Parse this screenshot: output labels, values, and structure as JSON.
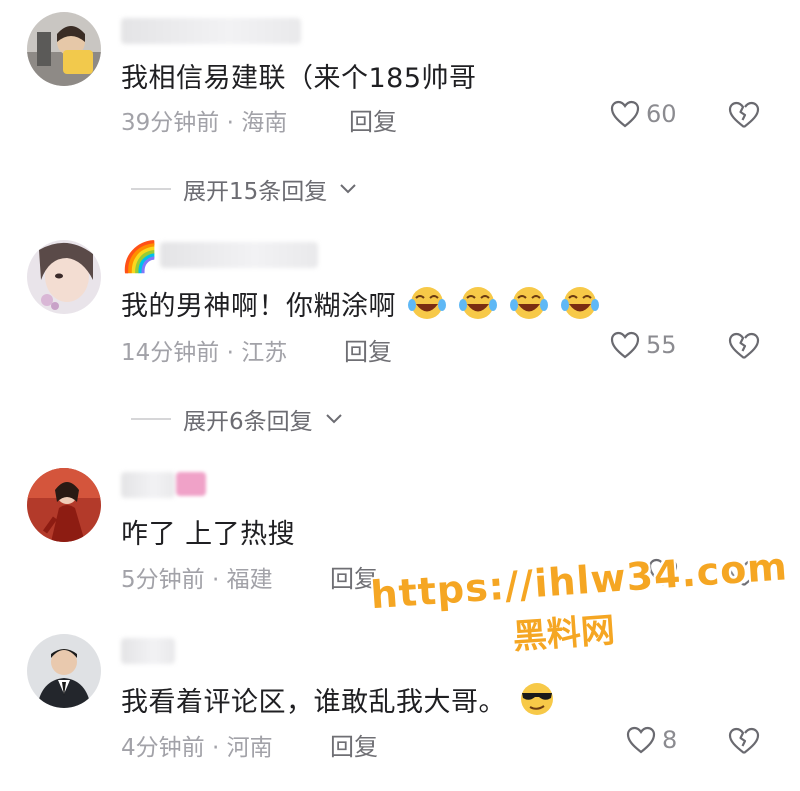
{
  "comments": [
    {
      "text": "我相信易建联（来个185帅哥",
      "time": "39分钟前",
      "location": "海南",
      "reply_label": "回复",
      "likes": "60",
      "expand_label": "展开15条回复"
    },
    {
      "name_emoji": "🌈",
      "text": "我的男神啊！你糊涂啊",
      "emojis": [
        "laugh-cry-emoji",
        "laugh-cry-emoji",
        "laugh-cry-emoji",
        "laugh-cry-emoji"
      ],
      "time": "14分钟前",
      "location": "江苏",
      "reply_label": "回复",
      "likes": "55",
      "expand_label": "展开6条回复"
    },
    {
      "text": "咋了 上了热搜",
      "time": "5分钟前",
      "location": "福建",
      "reply_label": "回复",
      "likes": ""
    },
    {
      "text": "我看着评论区，谁敢乱我大哥。",
      "emojis": [
        "sunglasses-emoji"
      ],
      "time": "4分钟前",
      "location": "河南",
      "reply_label": "回复",
      "likes": "8"
    }
  ],
  "meta_separator": "·",
  "watermark": {
    "url": "https://ihlw34.com",
    "brand": "黑料网"
  },
  "colors": {
    "text": "#1f1f22",
    "meta": "#a2a2a8",
    "watermark": "#f5a623"
  }
}
